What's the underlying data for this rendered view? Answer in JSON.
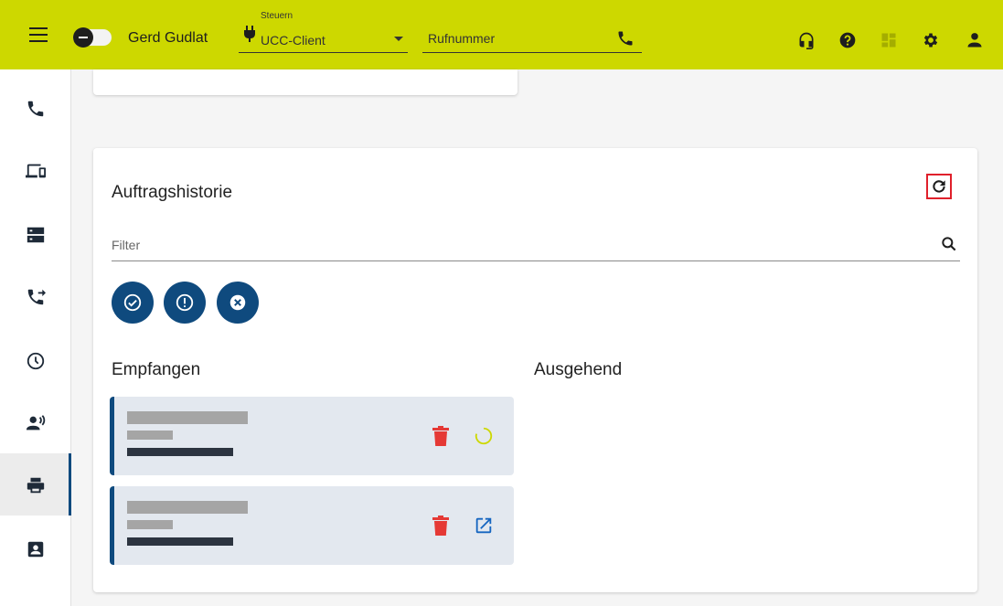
{
  "header": {
    "user_name": "Gerd Gudlat",
    "control_label": "Steuern",
    "control_value": "UCC-Client",
    "phone_placeholder": "Rufnummer"
  },
  "sidebar": {
    "items": [
      {
        "icon": "phone-icon"
      },
      {
        "icon": "devices-icon"
      },
      {
        "icon": "server-icon"
      },
      {
        "icon": "call-forward-icon"
      },
      {
        "icon": "clock-icon"
      },
      {
        "icon": "voicemail-icon"
      },
      {
        "icon": "printer-icon",
        "active": true
      },
      {
        "icon": "contacts-icon"
      }
    ]
  },
  "card": {
    "title": "Auftragshistorie",
    "filter_placeholder": "Filter",
    "received_title": "Empfangen",
    "outgoing_title": "Ausgehend",
    "status_filters": [
      "check-circle-icon",
      "warning-circle-icon",
      "cancel-circle-icon"
    ],
    "jobs": [
      {
        "state": "loading",
        "action_icon": "spinner-icon"
      },
      {
        "state": "done",
        "action_icon": "open-external-icon"
      }
    ]
  },
  "colors": {
    "topbar": "#cdd800",
    "accent": "#0f4a7e",
    "delete": "#e53935",
    "highlight": "#e0202b"
  }
}
